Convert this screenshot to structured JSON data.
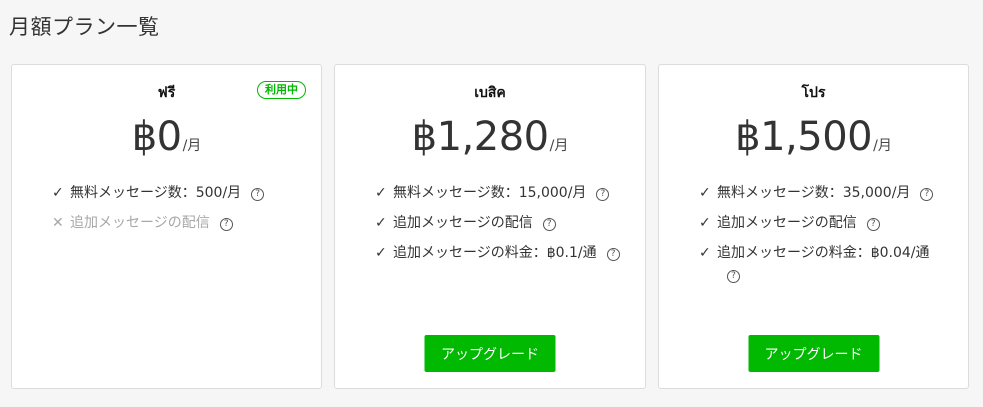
{
  "page": {
    "title": "月額プラン一覧"
  },
  "plans": [
    {
      "name": "ฟรี",
      "badge": "利用中",
      "price": "฿0",
      "per": "/月",
      "features": [
        {
          "enabled": true,
          "text": "無料メッセージ数：500/月"
        },
        {
          "enabled": false,
          "text": "追加メッセージの配信"
        }
      ]
    },
    {
      "name": "เบสิค",
      "price": "฿1,280",
      "per": "/月",
      "features": [
        {
          "enabled": true,
          "text": "無料メッセージ数：15,000/月"
        },
        {
          "enabled": true,
          "text": "追加メッセージの配信"
        },
        {
          "enabled": true,
          "text": "追加メッセージの料金：฿0.1/通"
        }
      ],
      "button": "アップグレード"
    },
    {
      "name": "โปร",
      "price": "฿1,500",
      "per": "/月",
      "features": [
        {
          "enabled": true,
          "text": "無料メッセージ数：35,000/月"
        },
        {
          "enabled": true,
          "text": "追加メッセージの配信"
        },
        {
          "enabled": true,
          "text": "追加メッセージの料金：฿0.04/通"
        }
      ],
      "button": "アップグレード"
    }
  ],
  "icons": {
    "check": "✓",
    "cross": "✕",
    "help": "?"
  },
  "colors": {
    "accent": "#00b900",
    "disabled_text": "#a7a7a7",
    "background": "#f6f6f6",
    "card": "#ffffff"
  }
}
